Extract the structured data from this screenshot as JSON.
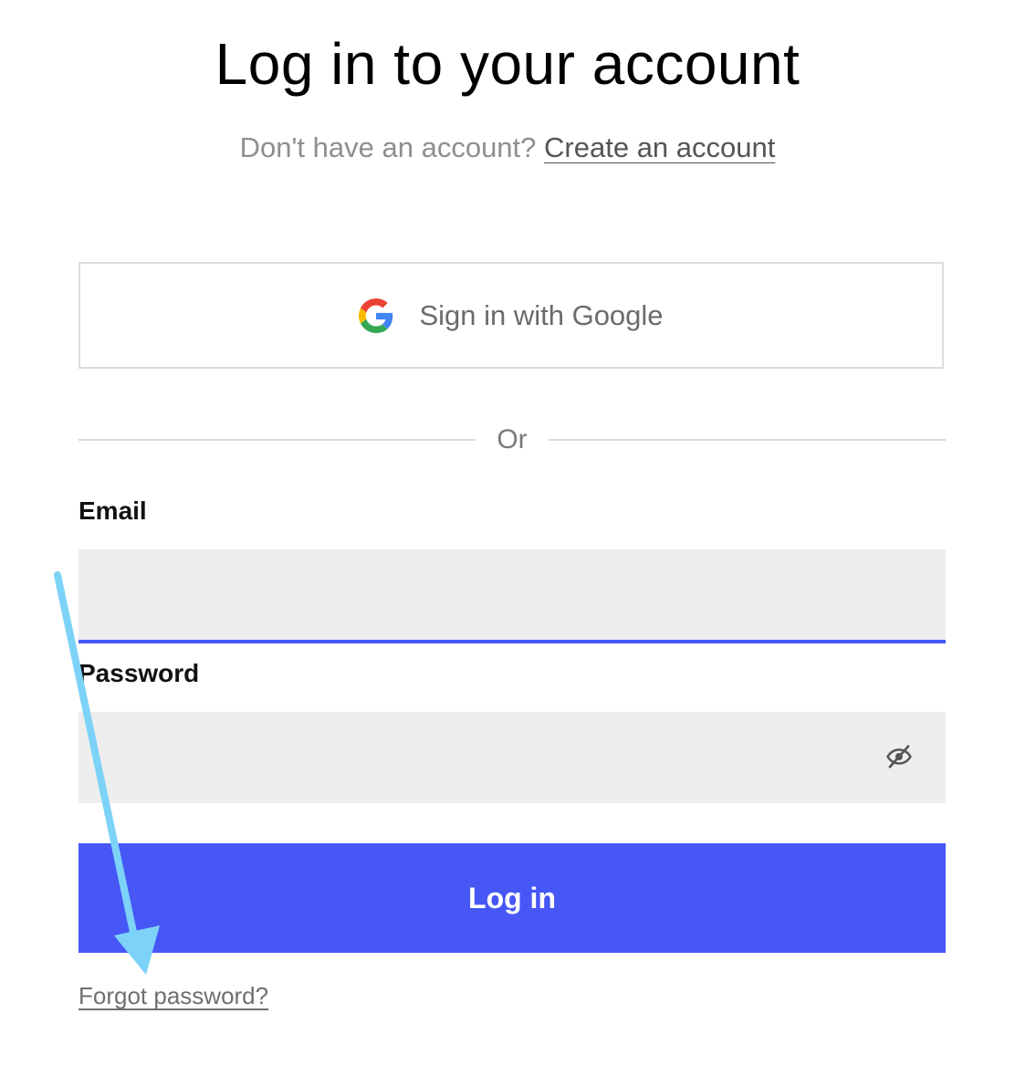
{
  "header": {
    "title": "Log in to your account",
    "no_account_text": "Don't have an account?",
    "create_account_link": "Create an account"
  },
  "google": {
    "label": "Sign in with Google",
    "icon": "google-icon"
  },
  "divider": {
    "label": "Or"
  },
  "form": {
    "email_label": "Email",
    "email_value": "",
    "password_label": "Password",
    "password_value": "",
    "password_toggle_icon": "eye-slash-icon",
    "submit_label": "Log in",
    "forgot_link": "Forgot password?"
  },
  "colors": {
    "accent": "#4657f5",
    "annotation_arrow": "#7dd3f7"
  }
}
